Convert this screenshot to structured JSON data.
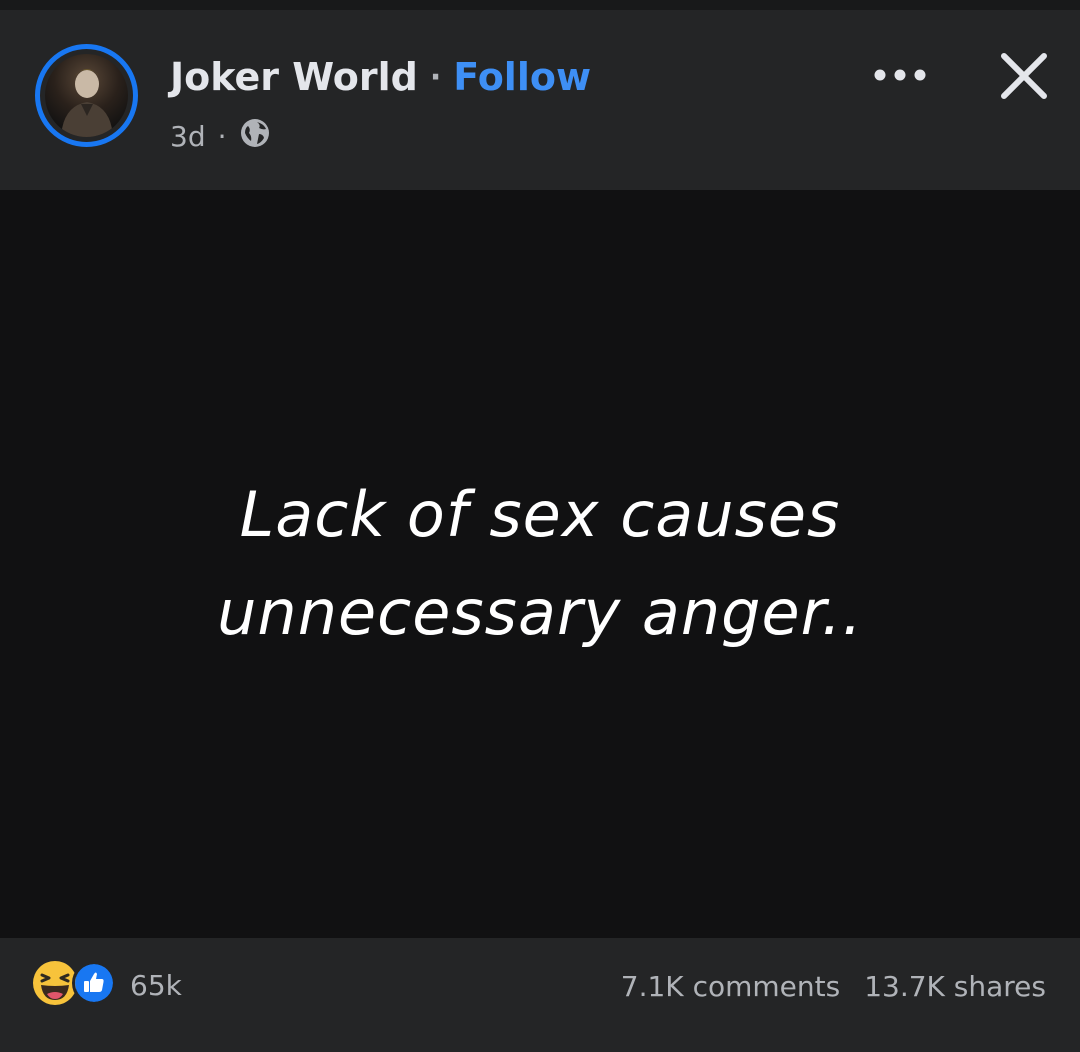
{
  "post": {
    "page_name": "Joker World",
    "separator": "·",
    "follow_label": "Follow",
    "time_ago": "3d",
    "meta_separator": "·",
    "audience_icon": "globe-icon",
    "text_line1": "Lack of sex causes",
    "text_line2": "unnecessary anger.."
  },
  "header": {
    "more_icon": "more-options-icon",
    "close_icon": "close-icon"
  },
  "footer": {
    "reaction_icons": [
      "haha-reaction-icon",
      "like-reaction-icon"
    ],
    "reaction_count": "65k",
    "comments": "7.1K comments",
    "shares": "13.7K shares"
  },
  "colors": {
    "accent": "#1877f2",
    "follow": "#3e8ff5",
    "background": "#242526",
    "post_background": "#111112",
    "text_secondary": "#b0b3b8"
  }
}
